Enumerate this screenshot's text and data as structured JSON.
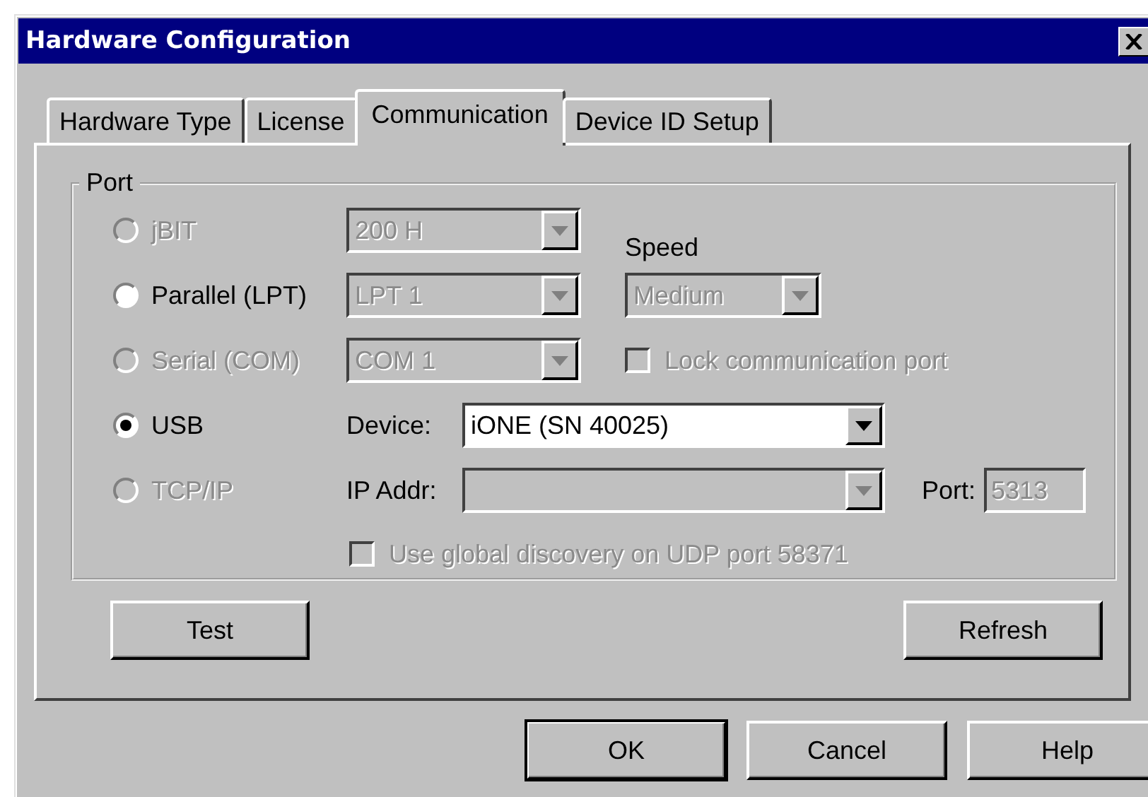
{
  "window": {
    "title": "Hardware Configuration"
  },
  "tabs": [
    {
      "label": "Hardware Type",
      "selected": false
    },
    {
      "label": "License",
      "selected": false
    },
    {
      "label": "Communication",
      "selected": true
    },
    {
      "label": "Device ID Setup",
      "selected": false
    }
  ],
  "port": {
    "title": "Port",
    "radios": [
      {
        "label": "jBIT",
        "selected": false,
        "disabled": true
      },
      {
        "label": "Parallel (LPT)",
        "selected": false,
        "disabled": false
      },
      {
        "label": "Serial (COM)",
        "selected": false,
        "disabled": true
      },
      {
        "label": "USB",
        "selected": true,
        "disabled": false
      },
      {
        "label": "TCP/IP",
        "selected": false,
        "disabled": true
      }
    ],
    "port_selects": [
      {
        "value": "200 H",
        "disabled": true
      },
      {
        "value": "LPT 1",
        "disabled": true
      },
      {
        "value": "COM 1",
        "disabled": true
      }
    ],
    "speed": {
      "label": "Speed",
      "value": "Medium",
      "disabled": true
    },
    "lock_port": {
      "label": "Lock communication port",
      "checked": false,
      "disabled": true
    },
    "device": {
      "label": "Device:",
      "value": "iONE (SN 40025)",
      "disabled": false
    },
    "ip_addr": {
      "label": "IP Addr:",
      "disabled": true
    },
    "port_field": {
      "label": "Port:",
      "value": "5313",
      "disabled": true
    },
    "global_discovery": {
      "label": "Use global discovery on UDP port 58371",
      "checked": false,
      "disabled": true
    }
  },
  "panel_buttons": [
    {
      "label": "Test"
    },
    {
      "label": "Refresh"
    }
  ],
  "dialog_buttons": [
    {
      "label": "OK",
      "default": true
    },
    {
      "label": "Cancel",
      "default": false
    },
    {
      "label": "Help",
      "default": false
    }
  ]
}
